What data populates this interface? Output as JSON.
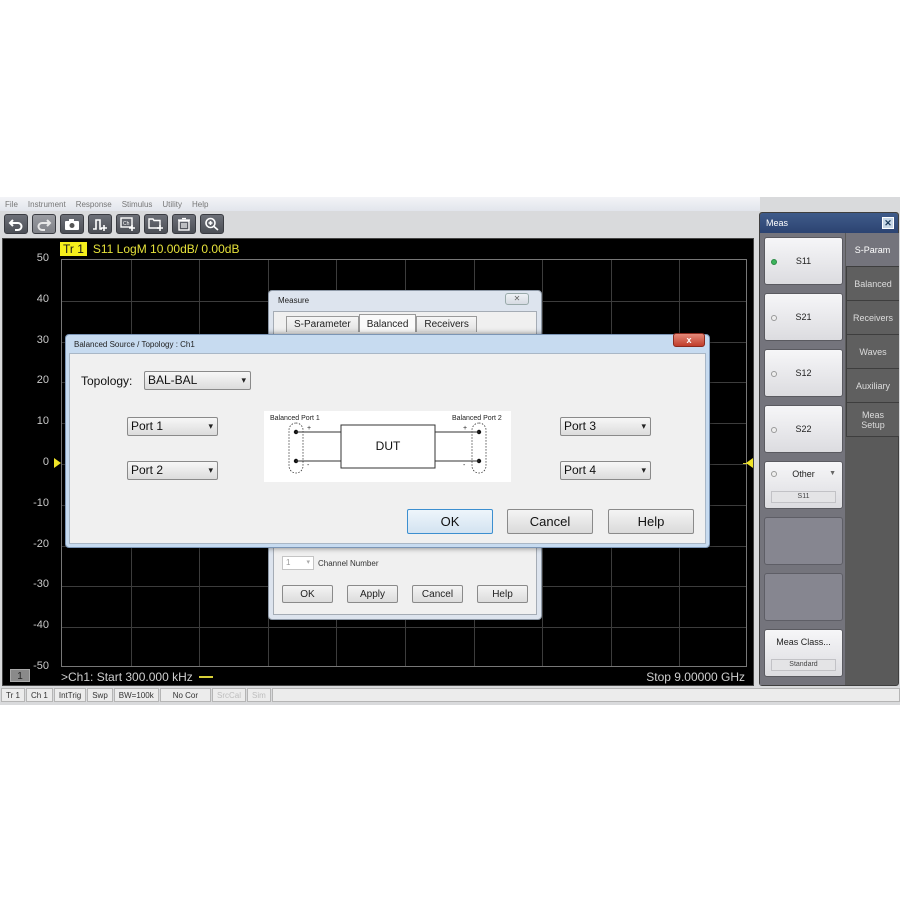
{
  "menu": [
    "File",
    "Instrument",
    "Response",
    "Stimulus",
    "Utility",
    "Help"
  ],
  "toolbar": [
    {
      "icon": "undo-icon",
      "enabled": true
    },
    {
      "icon": "redo-icon",
      "enabled": false
    },
    {
      "icon": "camera-icon",
      "enabled": true
    },
    {
      "icon": "add-trace-icon",
      "enabled": true
    },
    {
      "icon": "add-channel-icon",
      "enabled": true
    },
    {
      "icon": "add-window-icon",
      "enabled": true
    },
    {
      "icon": "trash-icon",
      "enabled": true
    },
    {
      "icon": "zoom-icon",
      "enabled": true
    }
  ],
  "plot": {
    "trace_badge": "Tr  1",
    "trace_desc": "S11 LogM 10.00dB/  0.00dB",
    "y_ticks": [
      "50",
      "40",
      "30",
      "20",
      "10",
      "0",
      "-10",
      "-20",
      "-30",
      "-40",
      "-50"
    ],
    "y_range": [
      -50,
      50
    ],
    "reference_level": 0,
    "x_divisions": 10,
    "channel_number": "1",
    "start_label": ">Ch1:  Start  300.000 kHz",
    "stop_label": "Stop  9.00000 GHz",
    "trace_color": "#e6e23a"
  },
  "statusbar": [
    {
      "label": "Tr 1",
      "dim": false
    },
    {
      "label": "Ch 1",
      "dim": false
    },
    {
      "label": "IntTrig",
      "dim": false
    },
    {
      "label": "Swp",
      "dim": false
    },
    {
      "label": "BW=100k",
      "dim": false
    },
    {
      "label": "No Cor",
      "dim": false
    },
    {
      "label": "SrcCal",
      "dim": true
    },
    {
      "label": "Sim",
      "dim": true
    }
  ],
  "meas_panel": {
    "title": "Meas",
    "close": "✕",
    "buttons": [
      {
        "label": "S11",
        "selected": true
      },
      {
        "label": "S21",
        "selected": false
      },
      {
        "label": "S12",
        "selected": false
      },
      {
        "label": "S22",
        "selected": false
      }
    ],
    "other": {
      "label": "Other",
      "sub": "S11"
    },
    "meas_class": {
      "label": "Meas Class...",
      "sub": "Standard"
    },
    "tabs": [
      "S-Param",
      "Balanced",
      "Receivers",
      "Waves",
      "Auxiliary",
      "Meas Setup"
    ],
    "active_tab": 0
  },
  "measure_dialog": {
    "title": "Measure",
    "close": "✕",
    "tabs": [
      "S-Parameter",
      "Balanced",
      "Receivers"
    ],
    "active_tab": 1,
    "channel_value": "1",
    "channel_label": "Channel Number",
    "buttons": [
      "OK",
      "Apply",
      "Cancel",
      "Help"
    ]
  },
  "balanced_dialog": {
    "title": "Balanced Source / Topology : Ch1",
    "close": "x",
    "topology_label": "Topology:",
    "topology_value": "BAL-BAL",
    "left_ports": [
      "Port 1",
      "Port 2"
    ],
    "right_ports": [
      "Port 3",
      "Port 4"
    ],
    "diagram": {
      "left_label": "Balanced Port 1",
      "right_label": "Balanced Port 2",
      "dut_label": "DUT",
      "plus": "+",
      "minus": "-"
    },
    "buttons": {
      "ok": "OK",
      "cancel": "Cancel",
      "help": "Help"
    }
  }
}
